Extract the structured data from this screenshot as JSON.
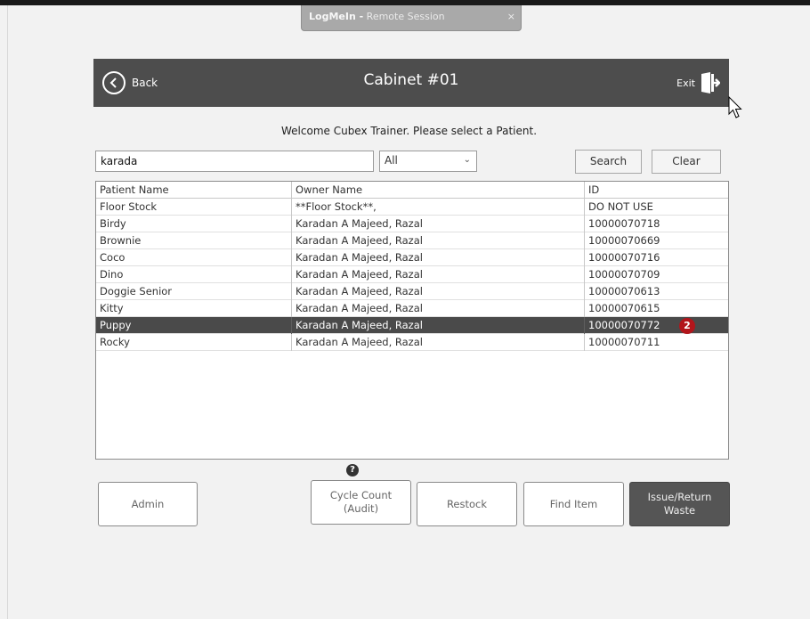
{
  "logmein": {
    "brand": "LogMeIn -",
    "session": "Remote Session",
    "close": "×"
  },
  "header": {
    "back_label": "Back",
    "title": "Cabinet #01",
    "exit_label": "Exit"
  },
  "welcome": "Welcome Cubex Trainer. Please select a Patient.",
  "search": {
    "value": "karada",
    "filter": "All",
    "search_label": "Search",
    "clear_label": "Clear"
  },
  "table": {
    "headers": [
      "Patient Name",
      "Owner Name",
      "ID"
    ],
    "rows": [
      [
        "Floor Stock",
        "**Floor Stock**,",
        "DO NOT USE"
      ],
      [
        "Birdy",
        "Karadan A Majeed, Razal",
        "10000070718"
      ],
      [
        "Brownie",
        "Karadan A Majeed, Razal",
        "10000070669"
      ],
      [
        "Coco",
        "Karadan A Majeed, Razal",
        "10000070716"
      ],
      [
        "Dino",
        "Karadan A Majeed, Razal",
        "10000070709"
      ],
      [
        "Doggie Senior",
        "Karadan A Majeed, Razal",
        "10000070613"
      ],
      [
        "Kitty",
        "Karadan A Majeed, Razal",
        "10000070615"
      ],
      [
        "Puppy",
        "Karadan A Majeed, Razal",
        "10000070772"
      ],
      [
        "Rocky",
        "Karadan A Majeed, Razal",
        "10000070711"
      ]
    ],
    "selected_badge": "2"
  },
  "actions": {
    "admin": "Admin",
    "cycle_line1": "Cycle Count",
    "cycle_line2": "(Audit)",
    "restock": "Restock",
    "find_item": "Find Item",
    "issue_line1": "Issue/Return",
    "issue_line2": "Waste"
  },
  "help_icon": "?",
  "colors": {
    "header_bg": "#4d4d4d",
    "selected_row": "#4a4a4a",
    "badge": "#b2151b"
  }
}
